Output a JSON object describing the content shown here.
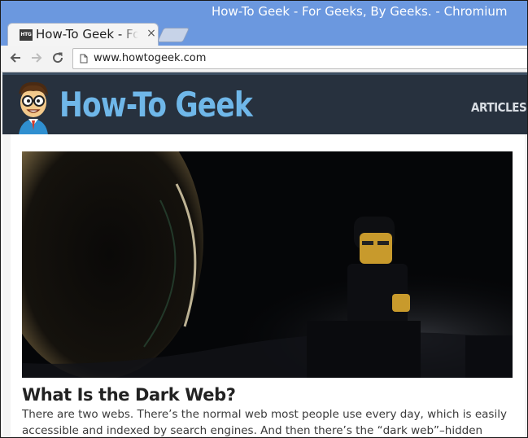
{
  "window": {
    "title": "How-To Geek - For Geeks, By Geeks. - Chromium"
  },
  "tab": {
    "favicon_text": "HTG",
    "title": "How-To Geek - For Geeks, By Geeks.",
    "close_glyph": "×"
  },
  "toolbar": {
    "back_icon": "arrow-left-icon",
    "forward_icon": "arrow-right-icon",
    "reload_icon": "reload-icon",
    "url": "www.howtogeek.com"
  },
  "site": {
    "logo_text": "How-To Geek",
    "nav": {
      "articles_label": "ARTICLES",
      "chevron": "⌄"
    }
  },
  "article": {
    "title": "What Is the Dark Web?",
    "excerpt": "There are two webs. There’s the normal web most people use every day, which is easily accessible and indexed by search engines. And then there’s the “dark web”–hidden websites"
  },
  "colors": {
    "titlebar": "#6b98df",
    "site_header": "#27313e",
    "logo": "#6fb7e9"
  }
}
